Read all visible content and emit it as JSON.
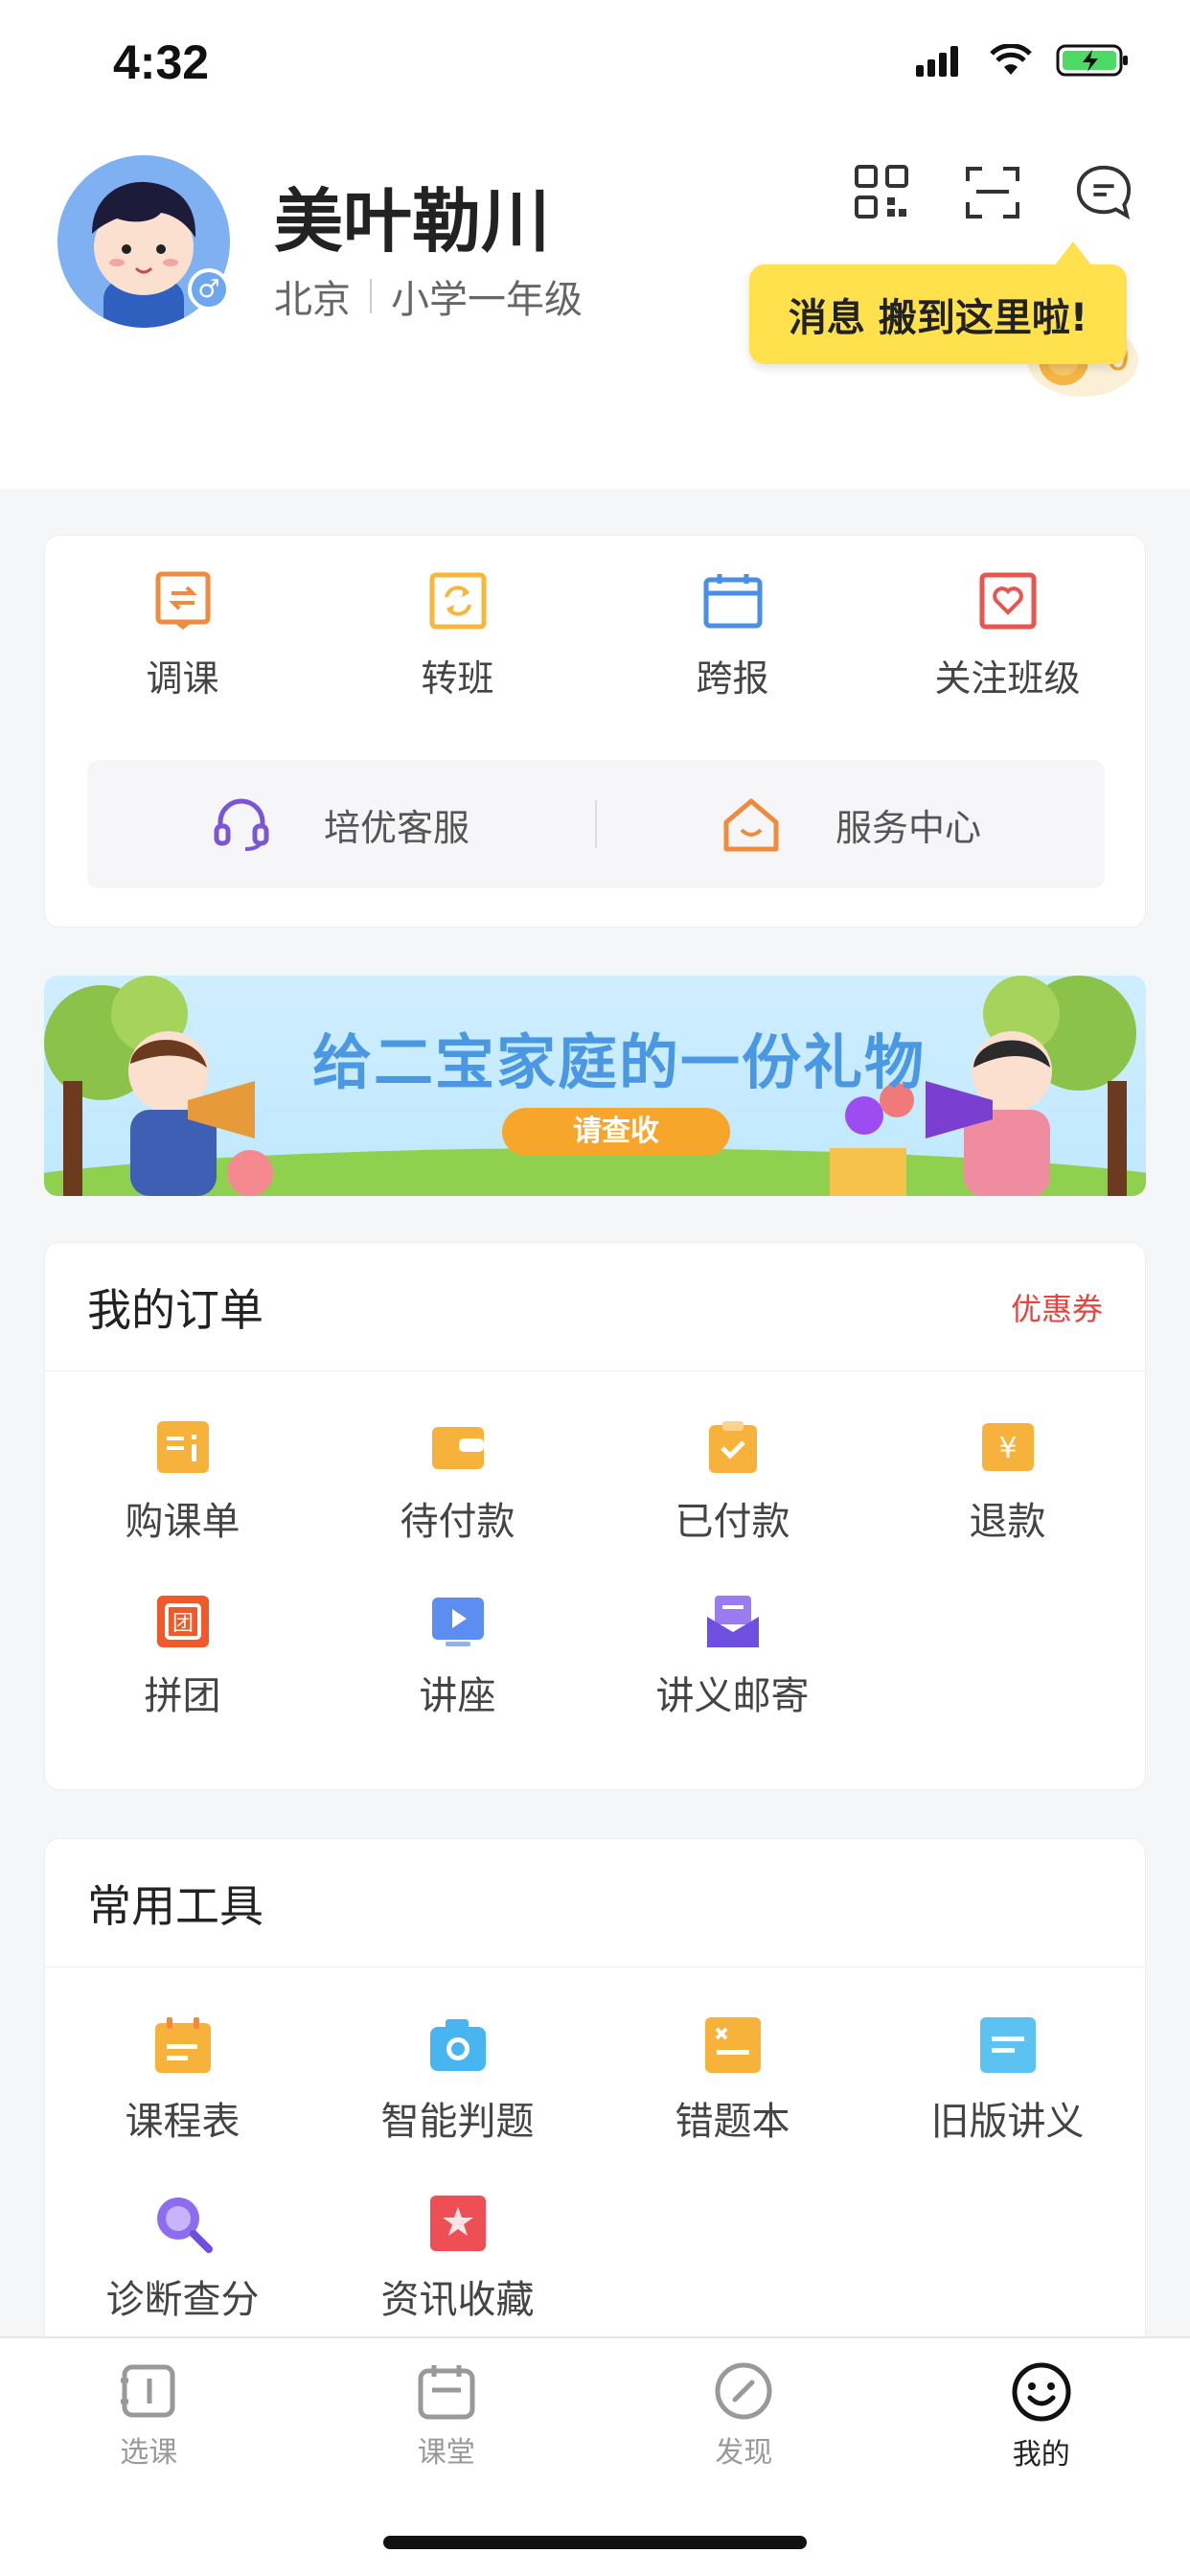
{
  "status_bar": {
    "time": "4:32"
  },
  "header": {
    "user_name": "美叶勒川",
    "city": "北京",
    "grade": "小学一年级",
    "coins": "0",
    "tooltip": "消息 搬到这里啦!",
    "gender_symbol": "♂"
  },
  "quick_actions": [
    {
      "label": "调课",
      "icon": "adjust-class-icon",
      "color": "#f08a3c"
    },
    {
      "label": "转班",
      "icon": "transfer-class-icon",
      "color": "#f6b73c"
    },
    {
      "label": "跨报",
      "icon": "calendar-icon",
      "color": "#4a8ee8"
    },
    {
      "label": "关注班级",
      "icon": "heart-card-icon",
      "color": "#e8554e"
    }
  ],
  "service": {
    "support_label": "培优客服",
    "center_label": "服务中心"
  },
  "banner": {
    "title": "给二宝家庭的一份礼物",
    "button": "请查收"
  },
  "orders": {
    "title": "我的订单",
    "coupon_link": "优惠券",
    "items": [
      {
        "label": "购课单",
        "icon": "cart-list-icon"
      },
      {
        "label": "待付款",
        "icon": "wallet-icon"
      },
      {
        "label": "已付款",
        "icon": "paid-check-icon"
      },
      {
        "label": "退款",
        "icon": "refund-yen-icon"
      },
      {
        "label": "拼团",
        "icon": "group-buy-icon"
      },
      {
        "label": "讲座",
        "icon": "lecture-play-icon"
      },
      {
        "label": "讲义邮寄",
        "icon": "mail-handout-icon"
      }
    ]
  },
  "tools": {
    "title": "常用工具",
    "items": [
      {
        "label": "课程表",
        "icon": "schedule-icon"
      },
      {
        "label": "智能判题",
        "icon": "camera-icon"
      },
      {
        "label": "错题本",
        "icon": "wrong-book-icon"
      },
      {
        "label": "旧版讲义",
        "icon": "old-handout-icon"
      },
      {
        "label": "诊断查分",
        "icon": "search-score-icon"
      },
      {
        "label": "资讯收藏",
        "icon": "star-favorite-icon"
      }
    ]
  },
  "tabbar": [
    {
      "label": "选课",
      "icon": "course-select-icon",
      "active": false
    },
    {
      "label": "课堂",
      "icon": "classroom-icon",
      "active": false
    },
    {
      "label": "发现",
      "icon": "discover-compass-icon",
      "active": false
    },
    {
      "label": "我的",
      "icon": "smile-profile-icon",
      "active": true
    }
  ]
}
